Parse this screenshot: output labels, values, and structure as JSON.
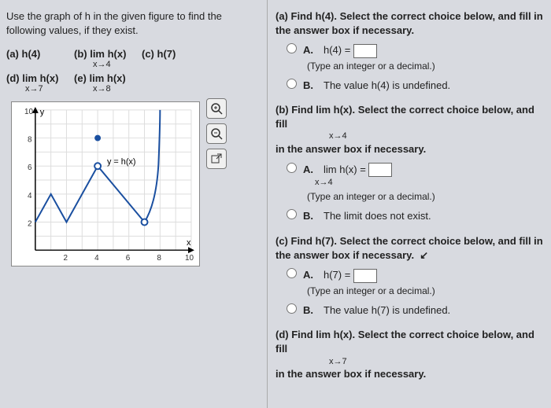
{
  "left": {
    "prompt": "Use the graph of h in the given figure to find the following values, if they exist.",
    "parts": {
      "a": "(a) h(4)",
      "b": "(b) lim h(x)",
      "b_sub": "x→4",
      "c": "(c) h(7)",
      "d": "(d) lim h(x)",
      "d_sub": "x→7",
      "e": "(e) lim h(x)",
      "e_sub": "x→8"
    },
    "graph": {
      "y_label": "y",
      "x_label": "x",
      "curve_label": "y = h(x)",
      "y_ticks": [
        "2",
        "4",
        "6",
        "8",
        "10"
      ],
      "x_ticks": [
        "2",
        "4",
        "6",
        "8",
        "10"
      ]
    },
    "tools": {
      "zoom_in": "zoom-in",
      "zoom_out": "zoom-out",
      "popout": "popout"
    }
  },
  "right": {
    "qa": {
      "prompt": "(a) Find h(4). Select the correct choice below, and fill in the answer box if necessary.",
      "A_label": "A.",
      "A_text": "h(4) = ",
      "A_hint": "(Type an integer or a decimal.)",
      "B_label": "B.",
      "B_text": "The value h(4) is undefined."
    },
    "qb": {
      "prompt_l1": "(b) Find lim h(x). Select the correct choice below, and fill",
      "prompt_sub": "x→4",
      "prompt_l2": "in the answer box if necessary.",
      "A_label": "A.",
      "A_text": "lim h(x) = ",
      "A_sub": "x→4",
      "A_hint": "(Type an integer or a decimal.)",
      "B_label": "B.",
      "B_text": "The limit does not exist."
    },
    "qc": {
      "prompt": "(c) Find h(7). Select the correct choice below, and fill in the answer box if necessary.",
      "A_label": "A.",
      "A_text": "h(7) = ",
      "A_hint": "(Type an integer or a decimal.)",
      "B_label": "B.",
      "B_text": "The value h(7) is undefined."
    },
    "qd": {
      "prompt_l1": "(d) Find lim h(x). Select the correct choice below, and fill",
      "prompt_sub": "x→7",
      "prompt_l2": "in the answer box if necessary."
    }
  },
  "chart_data": {
    "type": "line",
    "xlabel": "x",
    "ylabel": "y",
    "xlim": [
      0,
      10
    ],
    "ylim": [
      0,
      10
    ],
    "curve_label": "y = h(x)",
    "segments": [
      {
        "type": "polyline",
        "points": [
          [
            0,
            2
          ],
          [
            1,
            4
          ],
          [
            2,
            2
          ],
          [
            3,
            4
          ],
          [
            4,
            6
          ]
        ],
        "end_open_at": [
          4,
          6
        ]
      },
      {
        "type": "closed_point",
        "at": [
          4,
          8
        ]
      },
      {
        "type": "polyline",
        "points": [
          [
            4,
            6
          ],
          [
            7,
            2
          ]
        ],
        "start_open_at": [
          4,
          6
        ],
        "end_open_at": [
          7,
          2
        ]
      },
      {
        "type": "curve",
        "points": [
          [
            7,
            2
          ],
          [
            8,
            10
          ]
        ],
        "start_open_at": [
          7,
          2
        ]
      }
    ],
    "open_circles": [
      [
        4,
        6
      ],
      [
        7,
        2
      ]
    ],
    "closed_circles": [
      [
        4,
        8
      ]
    ]
  }
}
